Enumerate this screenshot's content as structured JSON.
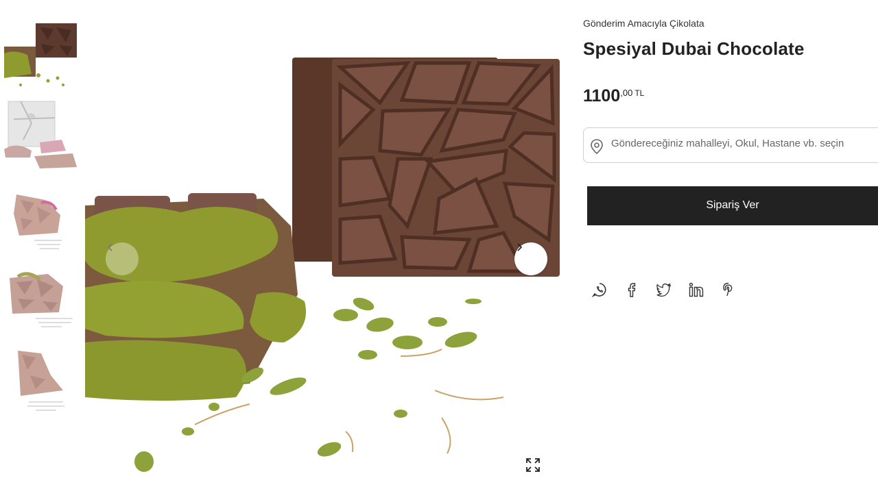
{
  "product": {
    "category": "Gönderim Amacıyla Çikolata",
    "title": "Spesiyal Dubai Chocolate",
    "price_integer": "1100",
    "price_decimal": ",00",
    "price_currency": "TL"
  },
  "location": {
    "placeholder": "Göndereceğiniz mahalleyi, Okul, Hastane vb. seçin",
    "icon": "map-pin-icon"
  },
  "order_button": {
    "label": "Sipariş Ver"
  },
  "gallery": {
    "thumbnail_count": 5,
    "controls": [
      "chevron-left-icon",
      "chevron-right-icon",
      "expand-icon"
    ]
  },
  "share": {
    "icons": [
      "whatsapp-icon",
      "facebook-icon",
      "twitter-icon",
      "linkedin-icon",
      "pinterest-icon"
    ]
  },
  "colors": {
    "button_bg": "#222222",
    "chocolate": "#6b4637",
    "pistachio": "#8a9a2e",
    "border": "#cfcfcf"
  }
}
